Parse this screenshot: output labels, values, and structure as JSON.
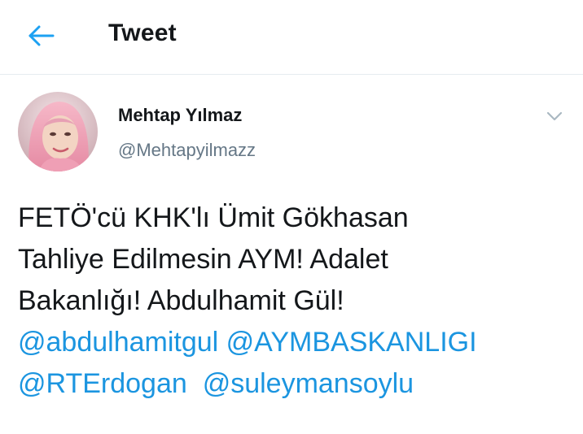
{
  "header": {
    "title": "Tweet",
    "back_icon": "arrow-left-icon"
  },
  "tweet": {
    "author": {
      "display_name": "Mehtap Yılmaz",
      "handle": "@Mehtapyilmazz"
    },
    "menu_icon": "chevron-down-icon",
    "text_lines": [
      "FETÖ'cü KHK'lı Ümit Gökhasan",
      "Tahliye Edilmesin AYM! Adalet",
      "Bakanlığı! Abdulhamit Gül!"
    ],
    "mentions": [
      "@abdulhamitgul",
      "@AYMBASKANLIGI",
      "@RTErdogan",
      "@suleymansoylu"
    ]
  },
  "colors": {
    "accent": "#1b95e0",
    "text": "#14171a",
    "secondary": "#657786",
    "divider": "#e6ecf0"
  }
}
